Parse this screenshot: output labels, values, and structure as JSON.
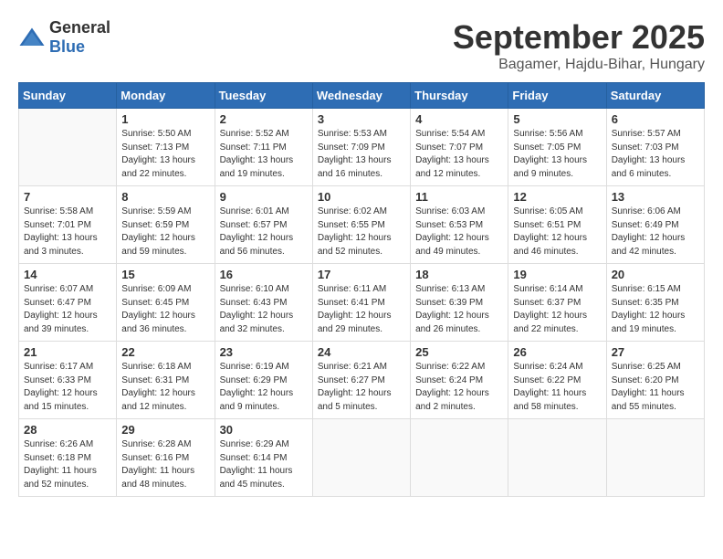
{
  "header": {
    "logo_general": "General",
    "logo_blue": "Blue",
    "month": "September 2025",
    "location": "Bagamer, Hajdu-Bihar, Hungary"
  },
  "days_of_week": [
    "Sunday",
    "Monday",
    "Tuesday",
    "Wednesday",
    "Thursday",
    "Friday",
    "Saturday"
  ],
  "weeks": [
    [
      {
        "day": "",
        "info": ""
      },
      {
        "day": "1",
        "info": "Sunrise: 5:50 AM\nSunset: 7:13 PM\nDaylight: 13 hours\nand 22 minutes."
      },
      {
        "day": "2",
        "info": "Sunrise: 5:52 AM\nSunset: 7:11 PM\nDaylight: 13 hours\nand 19 minutes."
      },
      {
        "day": "3",
        "info": "Sunrise: 5:53 AM\nSunset: 7:09 PM\nDaylight: 13 hours\nand 16 minutes."
      },
      {
        "day": "4",
        "info": "Sunrise: 5:54 AM\nSunset: 7:07 PM\nDaylight: 13 hours\nand 12 minutes."
      },
      {
        "day": "5",
        "info": "Sunrise: 5:56 AM\nSunset: 7:05 PM\nDaylight: 13 hours\nand 9 minutes."
      },
      {
        "day": "6",
        "info": "Sunrise: 5:57 AM\nSunset: 7:03 PM\nDaylight: 13 hours\nand 6 minutes."
      }
    ],
    [
      {
        "day": "7",
        "info": "Sunrise: 5:58 AM\nSunset: 7:01 PM\nDaylight: 13 hours\nand 3 minutes."
      },
      {
        "day": "8",
        "info": "Sunrise: 5:59 AM\nSunset: 6:59 PM\nDaylight: 12 hours\nand 59 minutes."
      },
      {
        "day": "9",
        "info": "Sunrise: 6:01 AM\nSunset: 6:57 PM\nDaylight: 12 hours\nand 56 minutes."
      },
      {
        "day": "10",
        "info": "Sunrise: 6:02 AM\nSunset: 6:55 PM\nDaylight: 12 hours\nand 52 minutes."
      },
      {
        "day": "11",
        "info": "Sunrise: 6:03 AM\nSunset: 6:53 PM\nDaylight: 12 hours\nand 49 minutes."
      },
      {
        "day": "12",
        "info": "Sunrise: 6:05 AM\nSunset: 6:51 PM\nDaylight: 12 hours\nand 46 minutes."
      },
      {
        "day": "13",
        "info": "Sunrise: 6:06 AM\nSunset: 6:49 PM\nDaylight: 12 hours\nand 42 minutes."
      }
    ],
    [
      {
        "day": "14",
        "info": "Sunrise: 6:07 AM\nSunset: 6:47 PM\nDaylight: 12 hours\nand 39 minutes."
      },
      {
        "day": "15",
        "info": "Sunrise: 6:09 AM\nSunset: 6:45 PM\nDaylight: 12 hours\nand 36 minutes."
      },
      {
        "day": "16",
        "info": "Sunrise: 6:10 AM\nSunset: 6:43 PM\nDaylight: 12 hours\nand 32 minutes."
      },
      {
        "day": "17",
        "info": "Sunrise: 6:11 AM\nSunset: 6:41 PM\nDaylight: 12 hours\nand 29 minutes."
      },
      {
        "day": "18",
        "info": "Sunrise: 6:13 AM\nSunset: 6:39 PM\nDaylight: 12 hours\nand 26 minutes."
      },
      {
        "day": "19",
        "info": "Sunrise: 6:14 AM\nSunset: 6:37 PM\nDaylight: 12 hours\nand 22 minutes."
      },
      {
        "day": "20",
        "info": "Sunrise: 6:15 AM\nSunset: 6:35 PM\nDaylight: 12 hours\nand 19 minutes."
      }
    ],
    [
      {
        "day": "21",
        "info": "Sunrise: 6:17 AM\nSunset: 6:33 PM\nDaylight: 12 hours\nand 15 minutes."
      },
      {
        "day": "22",
        "info": "Sunrise: 6:18 AM\nSunset: 6:31 PM\nDaylight: 12 hours\nand 12 minutes."
      },
      {
        "day": "23",
        "info": "Sunrise: 6:19 AM\nSunset: 6:29 PM\nDaylight: 12 hours\nand 9 minutes."
      },
      {
        "day": "24",
        "info": "Sunrise: 6:21 AM\nSunset: 6:27 PM\nDaylight: 12 hours\nand 5 minutes."
      },
      {
        "day": "25",
        "info": "Sunrise: 6:22 AM\nSunset: 6:24 PM\nDaylight: 12 hours\nand 2 minutes."
      },
      {
        "day": "26",
        "info": "Sunrise: 6:24 AM\nSunset: 6:22 PM\nDaylight: 11 hours\nand 58 minutes."
      },
      {
        "day": "27",
        "info": "Sunrise: 6:25 AM\nSunset: 6:20 PM\nDaylight: 11 hours\nand 55 minutes."
      }
    ],
    [
      {
        "day": "28",
        "info": "Sunrise: 6:26 AM\nSunset: 6:18 PM\nDaylight: 11 hours\nand 52 minutes."
      },
      {
        "day": "29",
        "info": "Sunrise: 6:28 AM\nSunset: 6:16 PM\nDaylight: 11 hours\nand 48 minutes."
      },
      {
        "day": "30",
        "info": "Sunrise: 6:29 AM\nSunset: 6:14 PM\nDaylight: 11 hours\nand 45 minutes."
      },
      {
        "day": "",
        "info": ""
      },
      {
        "day": "",
        "info": ""
      },
      {
        "day": "",
        "info": ""
      },
      {
        "day": "",
        "info": ""
      }
    ]
  ]
}
